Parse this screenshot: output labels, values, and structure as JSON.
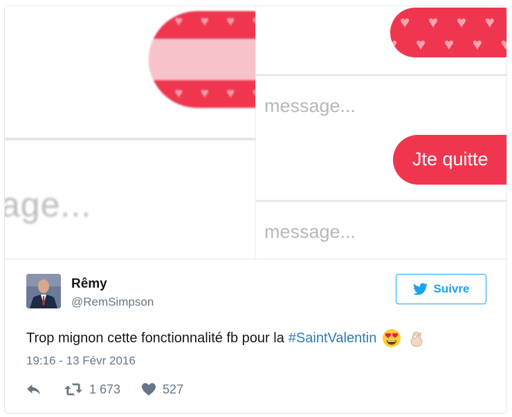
{
  "media": {
    "left_placeholder": "age...",
    "right_message_placeholder_1": "message...",
    "right_message_placeholder_2": "message...",
    "right_bubble_text": "Jte quitte"
  },
  "tweet": {
    "author_name": "Rêmy",
    "author_handle": "@RemSimpson",
    "follow_label": "Suivre",
    "text": "Trop mignon cette fonctionnalité fb pour la",
    "hashtag": "#SaintValentin",
    "timestamp": "19:16 - 13 Févr 2016",
    "retweet_count": "1 673",
    "like_count": "527"
  },
  "icons": {
    "follow": "twitter-bird-icon",
    "reply": "reply-icon",
    "retweet": "retweet-icon",
    "like": "heart-icon",
    "emoji_1": "heart-eyes-emoji-icon",
    "emoji_2": "ok-hand-emoji-icon"
  },
  "colors": {
    "accent": "#1da1f2",
    "hashtag": "#2b7bb9",
    "bubble": "#f0364f",
    "muted_text": "#657786"
  }
}
